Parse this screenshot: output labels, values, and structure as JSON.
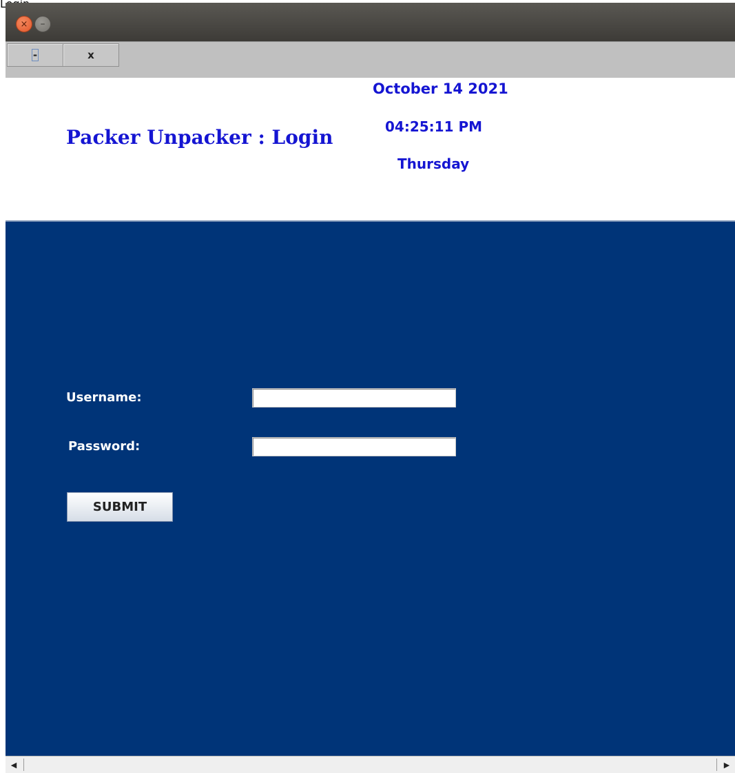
{
  "window": {
    "title": "Login",
    "close_glyph": "×",
    "minimize_glyph": "–"
  },
  "toolbar": {
    "minimize_label": "-",
    "close_label": "x"
  },
  "header": {
    "app_title": "Packer Unpacker : Login",
    "date": "October 14 2021",
    "time": "04:25:11 PM",
    "day": "Thursday"
  },
  "form": {
    "username_label": "Username:",
    "username_value": "",
    "password_label": "Password:",
    "password_value": "",
    "submit_label": "SUBMIT"
  },
  "scrollbar": {
    "left_arrow": "◀",
    "right_arrow": "▶"
  },
  "colors": {
    "panel_bg": "#003478",
    "header_text": "#1515d2",
    "toolbar_bg": "#c0c0c0"
  }
}
